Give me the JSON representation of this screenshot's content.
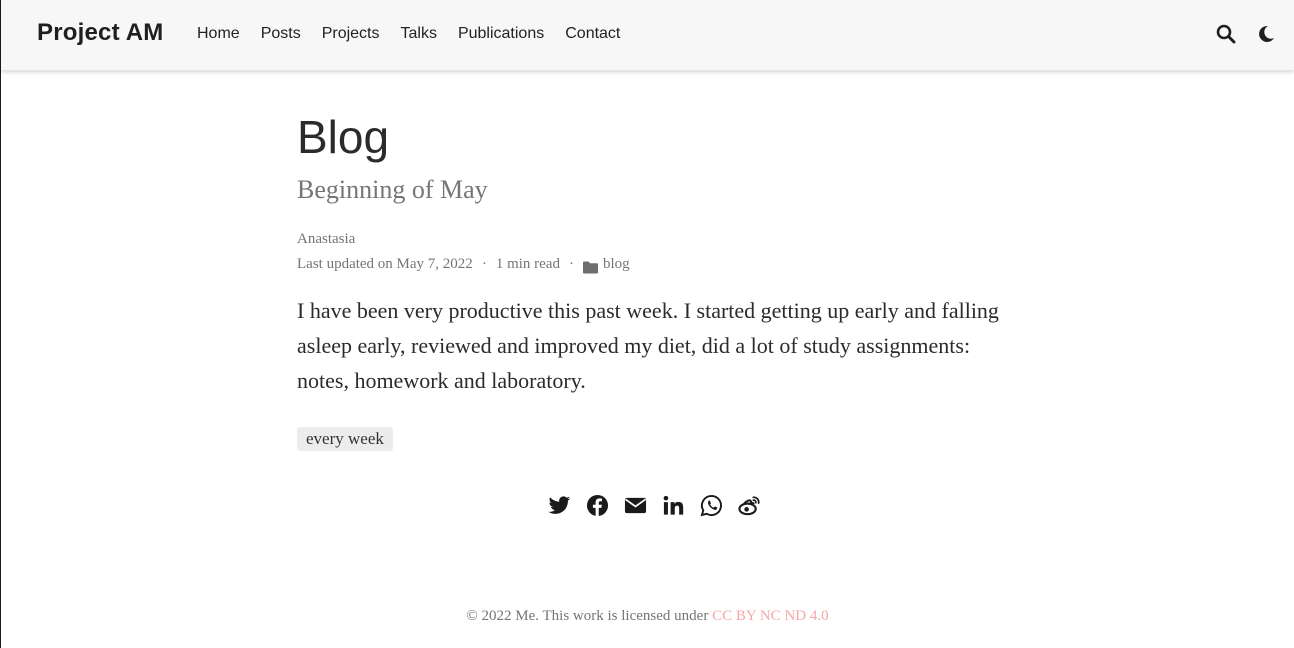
{
  "navbar": {
    "brand": "Project AM",
    "links": [
      "Home",
      "Posts",
      "Projects",
      "Talks",
      "Publications",
      "Contact"
    ],
    "icons": [
      "search-icon",
      "moon-icon"
    ]
  },
  "article": {
    "title": "Blog",
    "subtitle": "Beginning of May",
    "author": "Anastasia",
    "updated": "Last updated on May 7, 2022",
    "read_time": "1 min read",
    "category": "blog",
    "body": "I have been very productive this past week. I started getting up early and falling asleep early, reviewed and improved my diet, did a lot of study assignments: notes, homework and laboratory.",
    "tag": "every week",
    "separator": "·"
  },
  "share": {
    "icons": [
      "twitter-icon",
      "facebook-icon",
      "email-icon",
      "linkedin-icon",
      "whatsapp-icon",
      "weibo-icon"
    ]
  },
  "footer": {
    "text": "© 2022 Me. This work is licensed under",
    "license": "CC BY NC ND 4.0",
    "link_color": "#f6a6a6"
  }
}
